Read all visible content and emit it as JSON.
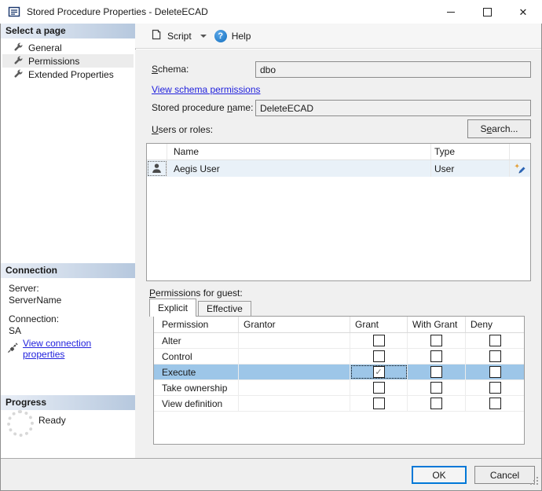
{
  "window": {
    "title": "Stored Procedure Properties - DeleteECAD"
  },
  "icons": {
    "close_glyph": "✕",
    "help_glyph": "?",
    "check_glyph": "✓"
  },
  "toolbar": {
    "script_label": "Script",
    "help_label": "Help"
  },
  "sidebar": {
    "select_a_page": {
      "header": "Select a page",
      "items": [
        {
          "label": "General"
        },
        {
          "label": "Permissions"
        },
        {
          "label": "Extended Properties"
        }
      ],
      "selected_index": 1
    },
    "connection": {
      "header": "Connection",
      "server_label": "Server:",
      "server_value": "ServerName",
      "connection_label": "Connection:",
      "connection_value": "SA",
      "link_label": "View connection properties"
    },
    "progress": {
      "header": "Progress",
      "status": "Ready"
    }
  },
  "form": {
    "schema_label": {
      "pre": "",
      "key": "S",
      "post": "chema:"
    },
    "schema_value": "dbo",
    "schema_link_label": "View schema permissions",
    "proc_label": {
      "pre": "Stored procedure ",
      "key": "n",
      "post": "ame:"
    },
    "proc_value": "DeleteECAD",
    "users_label": {
      "pre": "",
      "key": "U",
      "post": "sers or roles:"
    },
    "search_label": {
      "pre": "S",
      "key": "e",
      "post": "arch..."
    }
  },
  "users_table": {
    "columns": [
      "Name",
      "Type"
    ],
    "rows": [
      {
        "name": "Aegis User",
        "type": "User"
      }
    ]
  },
  "permissions": {
    "label": {
      "pre": "",
      "key": "P",
      "post": "ermissions for guest:"
    },
    "tabs": [
      "Explicit",
      "Effective"
    ],
    "active_tab": "Explicit",
    "columns": [
      "Permission",
      "Grantor",
      "Grant",
      "With Grant",
      "Deny"
    ],
    "rows": [
      {
        "permission": "Alter",
        "grantor": "",
        "grant": false,
        "with_grant": false,
        "deny": false,
        "selected": false
      },
      {
        "permission": "Control",
        "grantor": "",
        "grant": false,
        "with_grant": false,
        "deny": false,
        "selected": false
      },
      {
        "permission": "Execute",
        "grantor": "",
        "grant": true,
        "with_grant": false,
        "deny": false,
        "selected": true
      },
      {
        "permission": "Take ownership",
        "grantor": "",
        "grant": false,
        "with_grant": false,
        "deny": false,
        "selected": false
      },
      {
        "permission": "View definition",
        "grantor": "",
        "grant": false,
        "with_grant": false,
        "deny": false,
        "selected": false
      }
    ]
  },
  "footer": {
    "ok_label": "OK",
    "cancel_label": "Cancel"
  },
  "colors": {
    "accent": "#0078d7",
    "selection_blue": "#9dc6e8",
    "row_highlight": "#e9f1f8",
    "link": "#2222dd",
    "header_gradient_start": "#e9eef6",
    "header_gradient_end": "#b6c8de"
  }
}
